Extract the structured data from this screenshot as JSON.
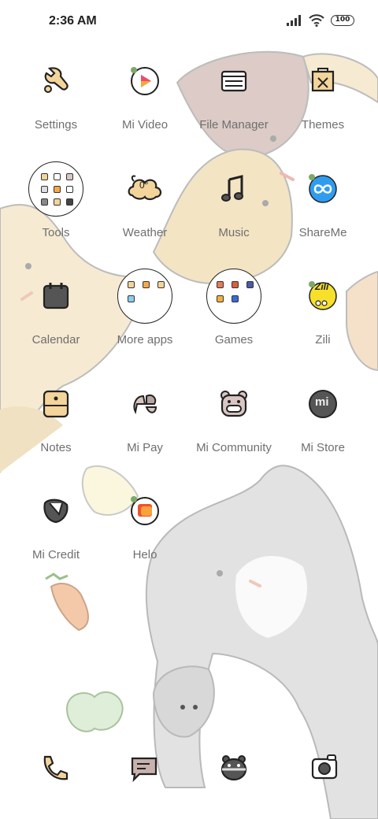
{
  "status": {
    "time": "2:36 AM",
    "battery": "100"
  },
  "rows": [
    [
      {
        "label": "Settings",
        "icon": "wrench-icon"
      },
      {
        "label": "Mi Video",
        "icon": "play-icon"
      },
      {
        "label": "File Manager",
        "icon": "folder-icon"
      },
      {
        "label": "Themes",
        "icon": "themes-icon"
      }
    ],
    [
      {
        "label": "Tools",
        "icon": "tools-folder-icon"
      },
      {
        "label": "Weather",
        "icon": "weather-cloud-icon",
        "badge": "0°"
      },
      {
        "label": "Music",
        "icon": "music-note-icon"
      },
      {
        "label": "ShareMe",
        "icon": "shareme-icon"
      }
    ],
    [
      {
        "label": "Calendar",
        "icon": "calendar-icon"
      },
      {
        "label": "More apps",
        "icon": "more-apps-folder-icon"
      },
      {
        "label": "Games",
        "icon": "games-folder-icon"
      },
      {
        "label": "Zili",
        "icon": "zili-icon",
        "badge": "Zili"
      }
    ],
    [
      {
        "label": "Notes",
        "icon": "notes-icon"
      },
      {
        "label": "Mi Pay",
        "icon": "mi-pay-icon"
      },
      {
        "label": "Mi Community",
        "icon": "mi-community-icon"
      },
      {
        "label": "Mi Store",
        "icon": "mi-store-icon",
        "badge": "mi"
      }
    ],
    [
      {
        "label": "Mi Credit",
        "icon": "mi-credit-icon"
      },
      {
        "label": "Helo",
        "icon": "helo-icon"
      }
    ]
  ],
  "dock": [
    {
      "icon": "phone-icon"
    },
    {
      "icon": "messages-icon"
    },
    {
      "icon": "browser-icon"
    },
    {
      "icon": "camera-icon"
    }
  ],
  "colors": {
    "beige": "#f6ead2",
    "tan": "#f0dfb8",
    "mauve": "#d9c6c2",
    "gray": "#dedede",
    "label": "#6f6f6f"
  }
}
